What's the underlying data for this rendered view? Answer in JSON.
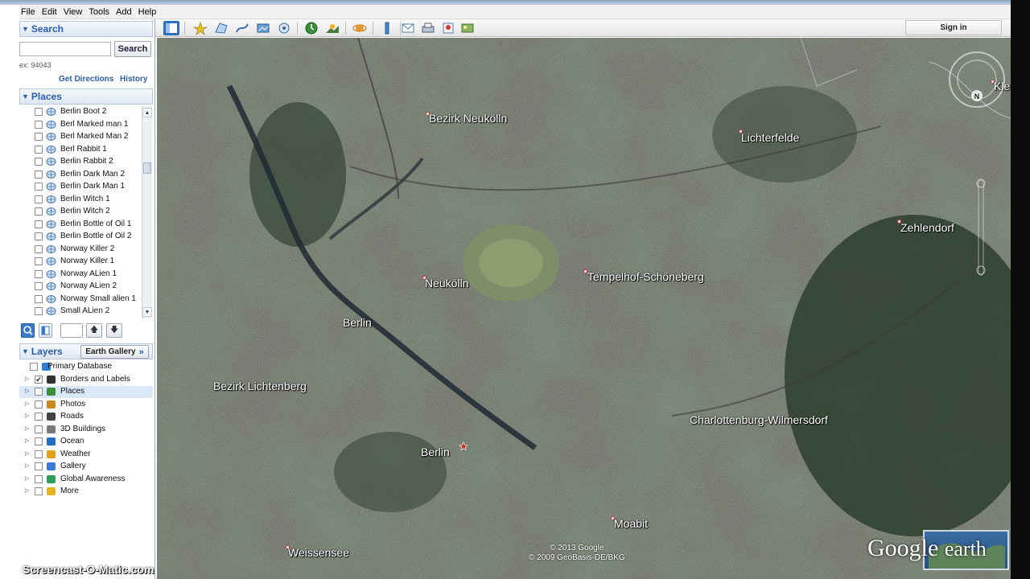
{
  "menu": [
    "File",
    "Edit",
    "View",
    "Tools",
    "Add",
    "Help"
  ],
  "search": {
    "header": "Search",
    "button": "Search",
    "hint": "ex: 94043",
    "get_directions": "Get Directions",
    "history": "History"
  },
  "places": {
    "header": "Places",
    "items": [
      {
        "label": "Berlin Boot 2"
      },
      {
        "label": "Berl Marked man 1"
      },
      {
        "label": "Berl Marked Man 2"
      },
      {
        "label": "Berl Rabbit 1"
      },
      {
        "label": "Berlin Rabbit 2"
      },
      {
        "label": "Berlin Dark Man 2"
      },
      {
        "label": "Berlin Dark Man 1"
      },
      {
        "label": "Berlin Witch 1"
      },
      {
        "label": "Berlin Witch 2"
      },
      {
        "label": "Berlin Bottle of Oil 1"
      },
      {
        "label": "Berlin Bottle of Oil 2"
      },
      {
        "label": "Norway Killer 2"
      },
      {
        "label": "Norway Killer 1"
      },
      {
        "label": "Norway ALien 1"
      },
      {
        "label": "Norway ALien 2"
      },
      {
        "label": "Norway Small alien 1"
      },
      {
        "label": "Small ALien 2"
      }
    ]
  },
  "layers": {
    "header": "Layers",
    "earth_gallery": "Earth Gallery",
    "items": [
      {
        "label": "Primary Database",
        "icon": "globe-icon",
        "checked": false
      },
      {
        "label": "Borders and Labels",
        "icon": "borders-icon",
        "checked": true
      },
      {
        "label": "Places",
        "icon": "places-icon",
        "checked": false
      },
      {
        "label": "Photos",
        "icon": "photos-icon",
        "checked": false
      },
      {
        "label": "Roads",
        "icon": "roads-icon",
        "checked": false
      },
      {
        "label": "3D Buildings",
        "icon": "buildings-icon",
        "checked": false
      },
      {
        "label": "Ocean",
        "icon": "ocean-icon",
        "checked": false
      },
      {
        "label": "Weather",
        "icon": "weather-icon",
        "checked": false
      },
      {
        "label": "Gallery",
        "icon": "gallery-icon",
        "checked": false
      },
      {
        "label": "Global Awareness",
        "icon": "global-awareness-icon",
        "checked": false
      },
      {
        "label": "More",
        "icon": "more-icon",
        "checked": false
      }
    ]
  },
  "toolbar": {
    "sign_in": "Sign in"
  },
  "map": {
    "labels": [
      {
        "text": "Bezirk Neukölln"
      },
      {
        "text": "Lichterfelde"
      },
      {
        "text": "Zehlendorf"
      },
      {
        "text": "Neukölln"
      },
      {
        "text": "Tempelhof-Schöneberg"
      },
      {
        "text": "Berlin"
      },
      {
        "text": "Bezirk Lichtenberg"
      },
      {
        "text": "Charlottenburg-Wilmersdorf"
      },
      {
        "text": "Berlin"
      },
      {
        "text": "Moabit"
      },
      {
        "text": "Weissensee"
      },
      {
        "text": "Kle"
      }
    ],
    "copyright_1": "© 2013 Google",
    "copyright_2": "© 2009 GeoBasis-DE/BKG",
    "logo_google": "Google",
    "logo_earth": "earth",
    "compass_letter": "N"
  },
  "watermark": "Screencast-O-Matic.com"
}
